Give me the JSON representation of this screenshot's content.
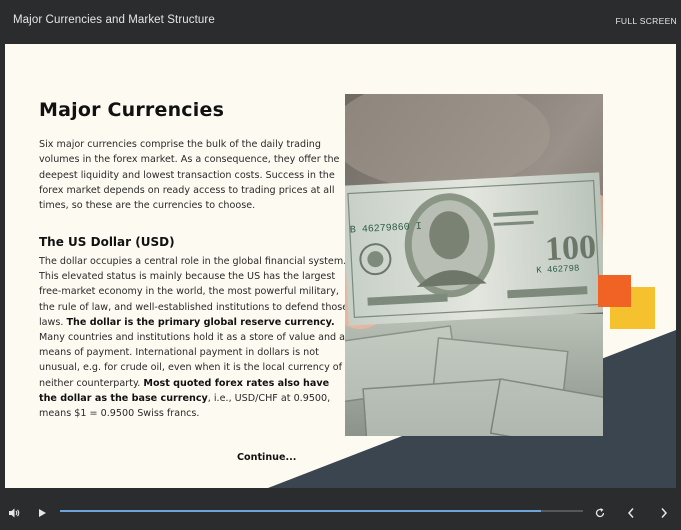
{
  "header": {
    "course_title": "Major Currencies and Market Structure",
    "fullscreen_label": "FULL SCREEN"
  },
  "slide": {
    "heading": "Major Currencies",
    "intro": "Six major currencies comprise the bulk of the daily trading volumes in the forex market. As a consequence, they offer the deepest liquidity and lowest transaction costs. Success in the forex market depends on ready access to trading prices at all times, so these are the currencies to choose.",
    "subheading": "The US Dollar (USD)",
    "body": {
      "p1": "The dollar occupies a central role in the global financial system. This elevated status is mainly because the US has the largest free-market economy in the world, the most powerful military, the rule of law, and well-established institutions to defend those laws. ",
      "b1": "The dollar is the primary global reserve currency.",
      "p2": " Many countries and institutions hold it as a store of value and a means of payment. International payment in dollars is not unusual, e.g. for crude oil, even when it is the local currency of neither counterparty. ",
      "b2": "Most quoted forex rates also have the dollar as the base currency",
      "p3": ", i.e., USD/CHF at 0.9500, means $1 = 0.9500 Swiss francs."
    },
    "continue_label": "Continue...",
    "photo": {
      "serial_left": "B 46279860 I",
      "serial_right": "K 462798",
      "denomination": "100"
    },
    "colors": {
      "background": "#fdfaf1",
      "dark_panel": "#3b4550",
      "accent_orange": "#f16225",
      "accent_yellow": "#f6c12e"
    }
  },
  "player": {
    "progress_fraction": 0.92,
    "progress_color": "#6fa3dc",
    "icons": {
      "volume": "volume-icon",
      "play": "play-icon",
      "replay": "replay-icon",
      "previous": "previous-slide-icon",
      "next": "next-slide-icon"
    }
  }
}
